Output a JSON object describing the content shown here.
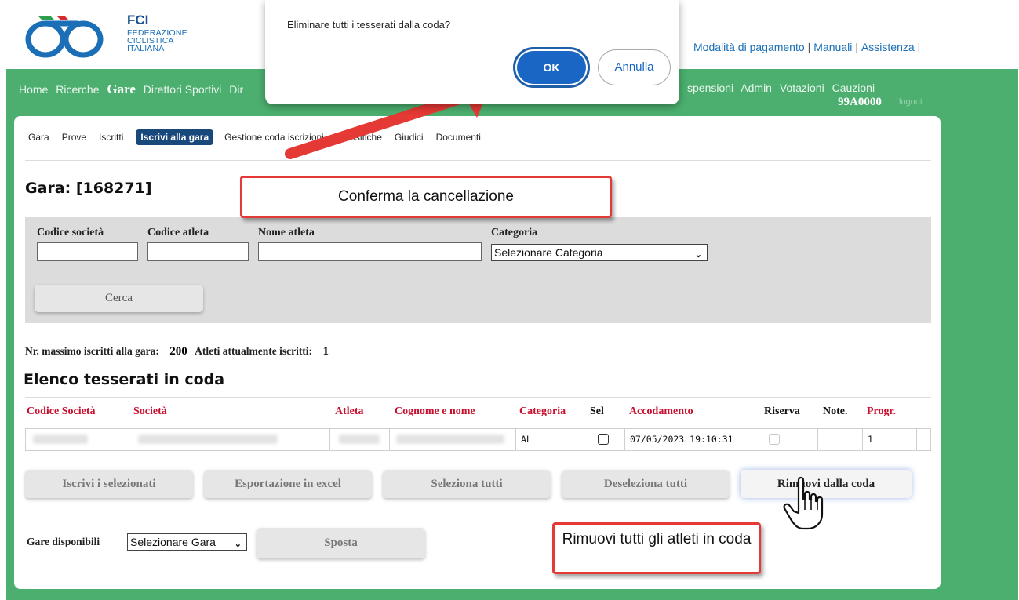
{
  "header": {
    "logo_title": "FCI",
    "logo_lines": [
      "FEDERAZIONE",
      "CICLISTICA",
      "ITALIANA"
    ],
    "top_links": [
      "Modalità di pagamento",
      "Manuali",
      "Assistenza"
    ]
  },
  "main_nav": {
    "left_items": [
      "Home",
      "Ricerche",
      "Gare",
      "Direttori Sportivi",
      "Dir"
    ],
    "active": "Gare",
    "right_items": [
      "spensioni",
      "Admin",
      "Votazioni",
      "Cauzioni"
    ],
    "user_code": "99A0000",
    "logout_label": "logout"
  },
  "sub_nav": {
    "items": [
      "Gara",
      "Prove",
      "Iscritti",
      "Iscrivi alla gara",
      "Gestione coda iscrizioni",
      "Classifiche",
      "Giudici",
      "Documenti"
    ],
    "active": "Iscrivi alla gara"
  },
  "page": {
    "title": "Gara: [168271]"
  },
  "search": {
    "labels": {
      "codice_societa": "Codice società",
      "codice_atleta": "Codice atleta",
      "nome_atleta": "Nome atleta",
      "categoria": "Categoria"
    },
    "values": {
      "codice_societa": "",
      "codice_atleta": "",
      "nome_atleta": ""
    },
    "categoria_selected": "Selezionare Categoria",
    "cerca_label": "Cerca"
  },
  "stats": {
    "max_label": "Nr. massimo iscritti alla gara:",
    "max_value": "200",
    "current_label": "Atleti attualmente iscritti:",
    "current_value": "1"
  },
  "queue": {
    "title": "Elenco tesserati in coda",
    "columns": [
      "Codice Società",
      "Società",
      "Atleta",
      "Cognome e nome",
      "Categoria",
      "Sel",
      "Accodamento",
      "Riserva",
      "Note.",
      "Progr."
    ],
    "rows": [
      {
        "codice_societa": "",
        "societa": "",
        "atleta": "",
        "cognome_nome": "",
        "categoria": "AL",
        "sel": false,
        "accodamento": "07/05/2023 19:10:31",
        "riserva": false,
        "note": "",
        "progr": "1"
      }
    ]
  },
  "actions": {
    "iscrivi": "Iscrivi i selezionati",
    "esporta": "Esportazione in excel",
    "seleziona": "Seleziona tutti",
    "deseleziona": "Deseleziona tutti",
    "rimuovi": "Rimuovi dalla coda"
  },
  "move": {
    "label": "Gare disponibili",
    "selected": "Selezionare Gara",
    "sposta": "Sposta"
  },
  "annotations": {
    "confirm": "Conferma la cancellazione",
    "remove_all": "Rimuovi tutti gli atleti in coda"
  },
  "dialog": {
    "message": "Eliminare tutti i tesserati dalla coda?",
    "ok": "OK",
    "cancel": "Annulla"
  },
  "colors": {
    "green": "#4caf6f",
    "navy": "#19487a",
    "red_header": "#c8102e",
    "callout_border": "#e53935",
    "ok_blue": "#1a66c4"
  }
}
